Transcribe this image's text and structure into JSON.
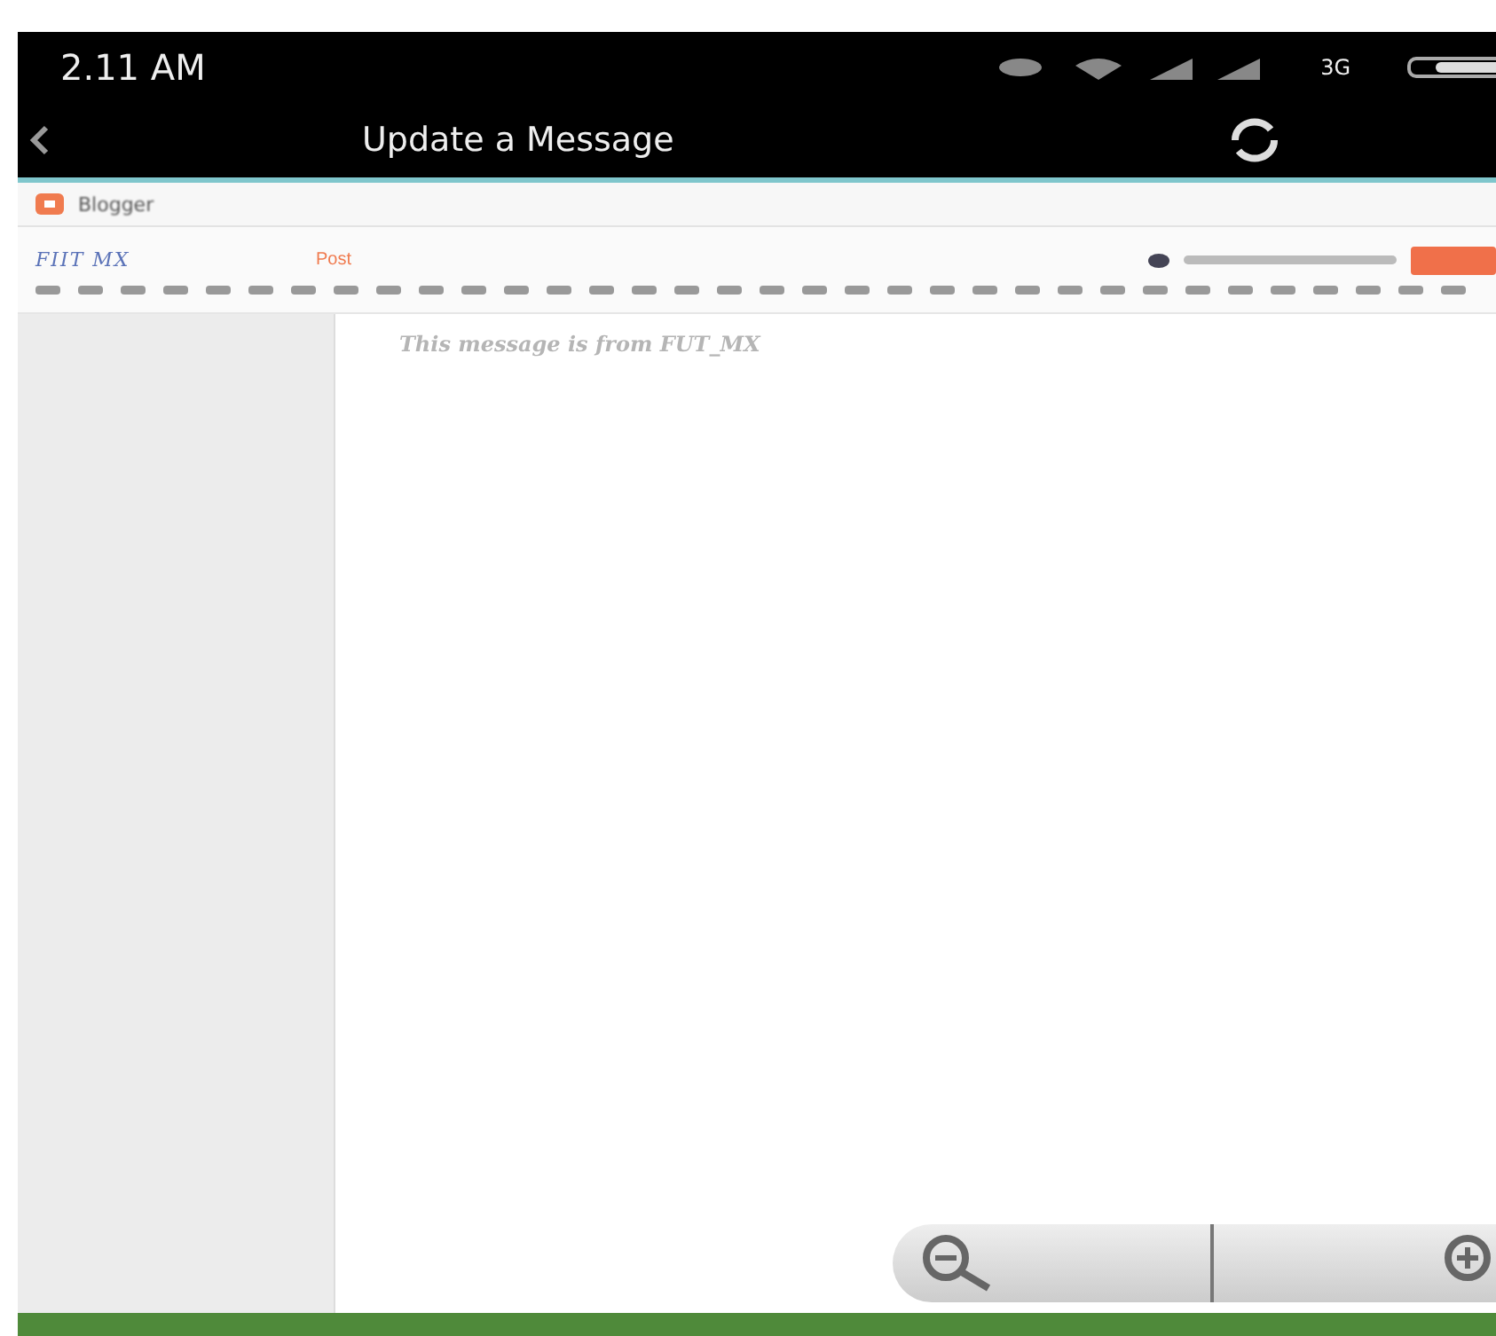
{
  "status_bar": {
    "time": "2.11 AM",
    "network": "3G"
  },
  "action_bar": {
    "title": "Update a Message"
  },
  "browser_tab": {
    "label": "Blogger"
  },
  "editor": {
    "blog_name": "FIIT MX",
    "mode_tabs": [
      {
        "label": "Post",
        "selected": true
      }
    ],
    "body": "This message is from FUT_MX"
  }
}
